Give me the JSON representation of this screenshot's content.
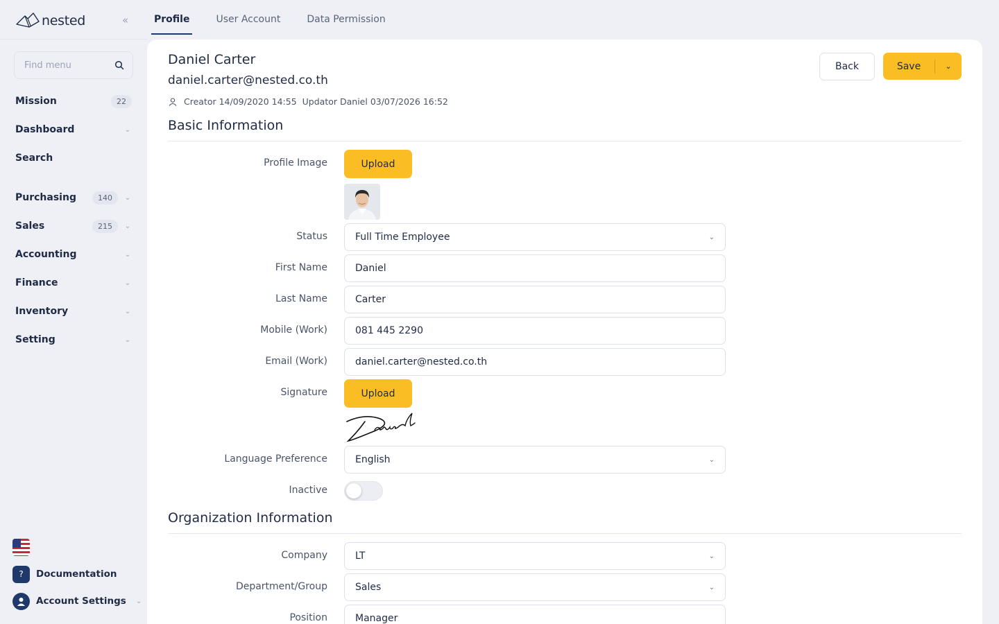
{
  "brand": {
    "name": "nested"
  },
  "sidebar": {
    "search_placeholder": "Find menu",
    "items": [
      {
        "label": "Mission",
        "badge": "22"
      },
      {
        "label": "Dashboard"
      },
      {
        "label": "Search"
      },
      {
        "label": "Purchasing",
        "badge": "140"
      },
      {
        "label": "Sales",
        "badge": "215"
      },
      {
        "label": "Accounting"
      },
      {
        "label": "Finance"
      },
      {
        "label": "Inventory"
      },
      {
        "label": "Setting"
      }
    ],
    "bottom": {
      "documentation": "Documentation",
      "account_settings": "Account Settings"
    }
  },
  "tabs": [
    "Profile",
    "User Account",
    "Data Permission"
  ],
  "header": {
    "name": "Daniel Carter",
    "email": "daniel.carter@nested.co.th",
    "creator": "Creator 14/09/2020 14:55",
    "updator": "Updator Daniel 03/07/2026 16:52",
    "back_label": "Back",
    "save_label": "Save"
  },
  "basic": {
    "title": "Basic Information",
    "profile_image_label": "Profile Image",
    "upload_label": "Upload",
    "status_label": "Status",
    "status_value": "Full Time Employee",
    "first_name_label": "First Name",
    "first_name_value": "Daniel",
    "last_name_label": "Last Name",
    "last_name_value": "Carter",
    "mobile_label": "Mobile (Work)",
    "mobile_value": "081 445 2290",
    "email_label": "Email (Work)",
    "email_value": "daniel.carter@nested.co.th",
    "signature_label": "Signature",
    "language_label": "Language Preference",
    "language_value": "English",
    "inactive_label": "Inactive",
    "inactive_value": false
  },
  "org": {
    "title": "Organization Information",
    "company_label": "Company",
    "company_value": "LT",
    "department_label": "Department/Group",
    "department_value": "Sales",
    "position_label": "Position",
    "position_value": "Manager"
  },
  "colors": {
    "accent": "#fbbd24",
    "primary": "#1f3a6a",
    "background": "#eef0f6"
  }
}
